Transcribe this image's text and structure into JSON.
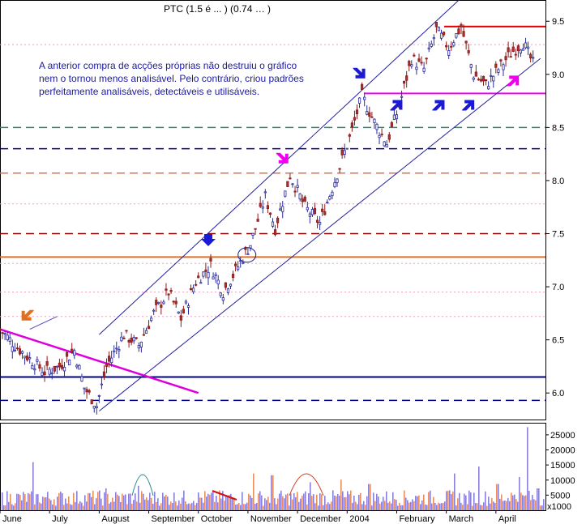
{
  "ticker_label": "PTC (1.5 é ... ) (0.74 … )",
  "annotation_text": "A anterior compra de acções próprias não destruiu o gráfico nem o tornou menos analisável. Pelo contrário, criou padrões perfeitamente analisáveis, detectáveis e utilisáveis.",
  "chart_data": [
    {
      "type": "bar",
      "subtype": "ohlc-price",
      "x_tick_labels": [
        "June",
        "July",
        "August",
        "September",
        "October",
        "November",
        "December",
        "2004",
        "February",
        "March",
        "April"
      ],
      "y_tick_labels": [
        "6.0",
        "6.5",
        "7.0",
        "7.5",
        "8.0",
        "8.5",
        "9.0",
        "9.5"
      ],
      "ylim": [
        5.75,
        9.7
      ],
      "grid": false,
      "price_path": [
        {
          "x": 0,
          "y": 6.6
        },
        {
          "x": 0.3,
          "y": 6.45
        },
        {
          "x": 0.6,
          "y": 6.32
        },
        {
          "x": 0.9,
          "y": 6.2
        },
        {
          "x": 1.2,
          "y": 6.25
        },
        {
          "x": 1.5,
          "y": 6.4
        },
        {
          "x": 1.7,
          "y": 6.05
        },
        {
          "x": 1.95,
          "y": 5.88
        },
        {
          "x": 2.15,
          "y": 6.25
        },
        {
          "x": 2.5,
          "y": 6.55
        },
        {
          "x": 2.8,
          "y": 6.45
        },
        {
          "x": 3.1,
          "y": 6.75
        },
        {
          "x": 3.4,
          "y": 6.95
        },
        {
          "x": 3.65,
          "y": 6.7
        },
        {
          "x": 3.95,
          "y": 7.05
        },
        {
          "x": 4.25,
          "y": 7.2
        },
        {
          "x": 4.5,
          "y": 6.95
        },
        {
          "x": 4.75,
          "y": 7.15
        },
        {
          "x": 5.05,
          "y": 7.4
        },
        {
          "x": 5.35,
          "y": 7.85
        },
        {
          "x": 5.55,
          "y": 7.55
        },
        {
          "x": 5.85,
          "y": 8.05
        },
        {
          "x": 6.15,
          "y": 7.75
        },
        {
          "x": 6.45,
          "y": 7.6
        },
        {
          "x": 6.75,
          "y": 8.0
        },
        {
          "x": 7.05,
          "y": 8.4
        },
        {
          "x": 7.3,
          "y": 8.8
        },
        {
          "x": 7.55,
          "y": 8.55
        },
        {
          "x": 7.8,
          "y": 8.35
        },
        {
          "x": 8.05,
          "y": 8.7
        },
        {
          "x": 8.3,
          "y": 9.15
        },
        {
          "x": 8.55,
          "y": 9.05
        },
        {
          "x": 8.8,
          "y": 9.42
        },
        {
          "x": 9.05,
          "y": 9.25
        },
        {
          "x": 9.3,
          "y": 9.45
        },
        {
          "x": 9.55,
          "y": 9.0
        },
        {
          "x": 9.8,
          "y": 8.9
        },
        {
          "x": 10.05,
          "y": 9.05
        },
        {
          "x": 10.3,
          "y": 9.2
        },
        {
          "x": 10.55,
          "y": 9.3
        },
        {
          "x": 10.8,
          "y": 9.05
        }
      ],
      "horizontal_lines": [
        {
          "y": 9.45,
          "color": "#dd0000",
          "style": "solid"
        },
        {
          "y": 8.82,
          "color": "#ee00ee",
          "style": "solid"
        },
        {
          "y": 8.5,
          "color": "#2a8a6a",
          "style": "dashed"
        },
        {
          "y": 8.3,
          "color": "#00008b",
          "style": "dashed"
        },
        {
          "y": 8.07,
          "color": "#e07040",
          "style": "dashed"
        },
        {
          "y": 7.5,
          "color": "#8b0000",
          "style": "dashed"
        },
        {
          "y": 7.28,
          "color": "#e07020",
          "style": "solid"
        },
        {
          "y": 6.15,
          "color": "#00008b",
          "style": "solid"
        },
        {
          "y": 5.93,
          "color": "#00008b",
          "style": "dashed"
        }
      ],
      "trend_channel": {
        "lower": [
          {
            "x": 2.0,
            "y": 5.83
          },
          {
            "x": 10.9,
            "y": 9.15
          }
        ],
        "upper": [
          {
            "x": 2.0,
            "y": 6.55
          },
          {
            "x": 9.6,
            "y": 9.85
          }
        ]
      },
      "downtrend_line": [
        {
          "x": 0.0,
          "y": 6.6
        },
        {
          "x": 4.0,
          "y": 6.0
        }
      ],
      "arrows": [
        {
          "x": 0.55,
          "y": 6.72,
          "color": "#e07020",
          "dir": "down-left"
        },
        {
          "x": 4.2,
          "y": 7.42,
          "color": "#1a1ad6",
          "dir": "down"
        },
        {
          "x": 5.7,
          "y": 8.2,
          "color": "#ee00ee",
          "dir": "down-right"
        },
        {
          "x": 7.25,
          "y": 9.0,
          "color": "#1a1ad6",
          "dir": "down-right"
        },
        {
          "x": 8.0,
          "y": 8.72,
          "color": "#1a1ad6",
          "dir": "up-right"
        },
        {
          "x": 8.85,
          "y": 8.72,
          "color": "#1a1ad6",
          "dir": "up-right"
        },
        {
          "x": 9.45,
          "y": 8.72,
          "color": "#1a1ad6",
          "dir": "up-right"
        },
        {
          "x": 10.35,
          "y": 8.95,
          "color": "#ee00ee",
          "dir": "up-right"
        }
      ]
    },
    {
      "type": "bar",
      "subtype": "volume",
      "y_tick_labels": [
        "5000",
        "10000",
        "15000",
        "20000",
        "25000"
      ],
      "ylim": [
        0,
        29000
      ],
      "unit_label": "x1000",
      "seed": 7
    }
  ]
}
